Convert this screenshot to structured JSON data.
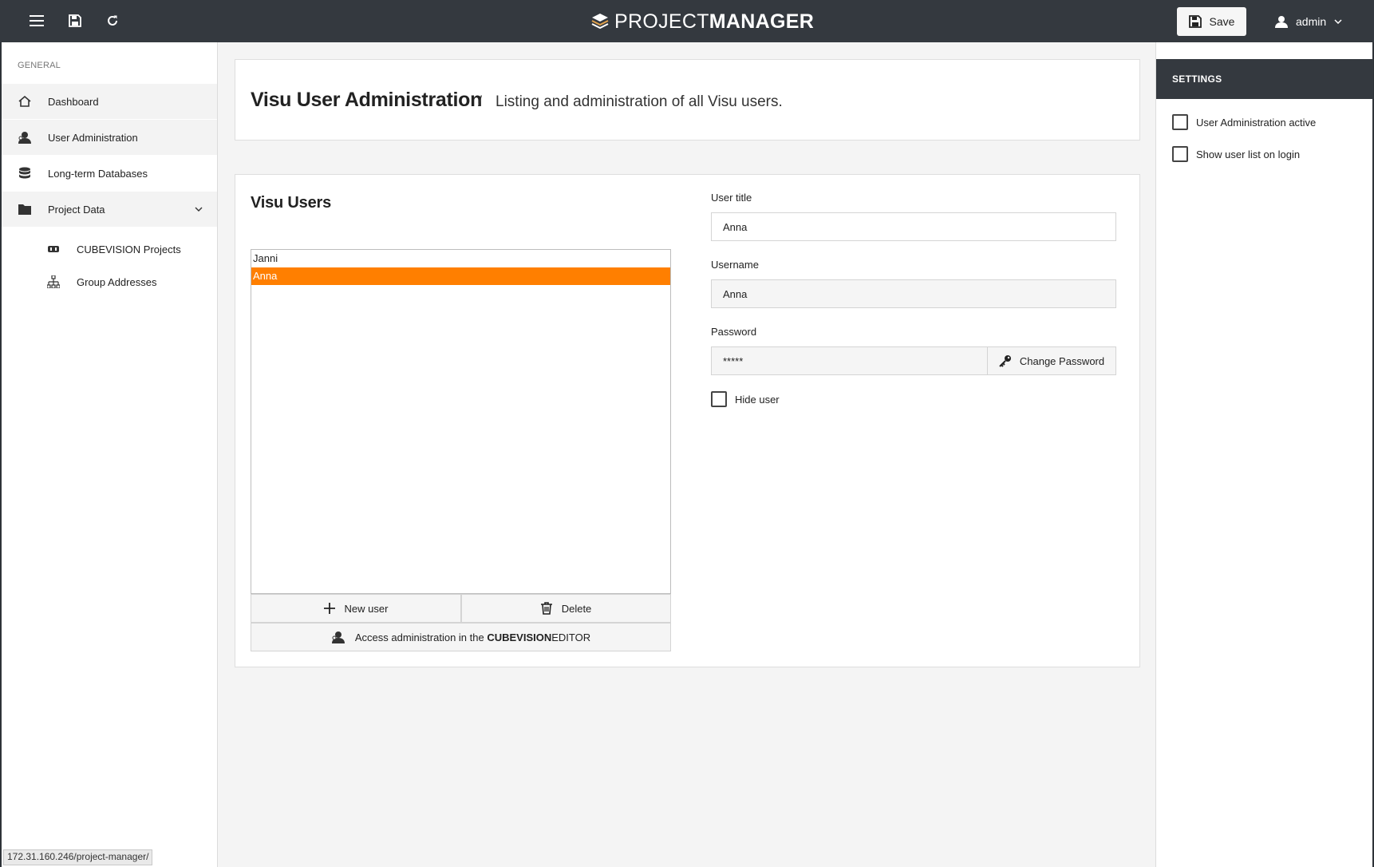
{
  "topbar": {
    "logo_light": "PROJECT",
    "logo_bold": "MANAGER",
    "save_label": "Save",
    "user_label": "admin",
    "menu_icon": "hamburger-icon",
    "save_icon": "floppy-icon",
    "reload_icon": "refresh-icon",
    "user_icon": "user-icon"
  },
  "sidebar": {
    "section_label": "GENERAL",
    "items": [
      {
        "label": "Dashboard",
        "icon": "home-icon"
      },
      {
        "label": "User Administration",
        "icon": "user-admin-icon"
      },
      {
        "label": "Long-term Databases",
        "icon": "database-icon"
      },
      {
        "label": "Project Data",
        "icon": "folder-icon"
      }
    ],
    "sub_items": [
      {
        "label": "CUBEVISION Projects",
        "icon": "cubevision-icon"
      },
      {
        "label": "Group Addresses",
        "icon": "hierarchy-icon"
      }
    ],
    "status_url": "172.31.160.246/project-manager/"
  },
  "header": {
    "title": "Visu User Administration",
    "separator": "/",
    "subtitle": "Listing and administration of all Visu users."
  },
  "users": {
    "title": "Visu Users",
    "list": [
      "Janni",
      "Anna"
    ],
    "selected": "Anna",
    "new_user_label": "New user",
    "delete_label": "Delete",
    "access_prefix": "Access administration in the ",
    "access_bold": "CUBEVISION",
    "access_suffix": "EDITOR"
  },
  "form": {
    "user_title_label": "User title",
    "user_title_value": "Anna",
    "username_label": "Username",
    "username_value": "Anna",
    "password_label": "Password",
    "password_value": "*****",
    "change_password_label": "Change Password",
    "hide_user_label": "Hide user",
    "hide_user_checked": false
  },
  "settings": {
    "title": "SETTINGS",
    "options": [
      {
        "label": "User Administration active",
        "checked": false
      },
      {
        "label": "Show user list on login",
        "checked": false
      }
    ]
  },
  "colors": {
    "topbar": "#34393f",
    "accent": "#ff7f00"
  }
}
